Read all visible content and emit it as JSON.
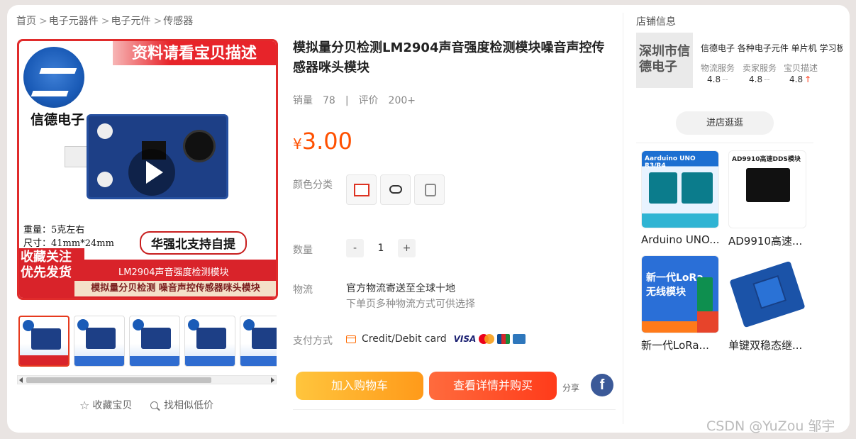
{
  "breadcrumb": [
    "首页",
    "电子元器件",
    "电子元件",
    "传感器"
  ],
  "breadcrumb_sep": ">",
  "main_image": {
    "banner": "资料请看宝贝描述",
    "brand": "信德电子",
    "weight": "重量：5克左右",
    "size": "尺寸：41mm*24mm",
    "support": "华强北支持自提",
    "favorite_tag_line1": "收藏关注",
    "favorite_tag_line2": "优先发货",
    "band_line1": "LM2904声音强度检测模块",
    "band_line2": "模拟量分贝检测  噪音声控传感器咪头模块",
    "play_icon": "play-icon"
  },
  "thumbnails_count": 5,
  "under_image": {
    "favorite": "收藏宝贝",
    "find_similar": "找相似低价"
  },
  "product": {
    "title": "模拟量分贝检测LM2904声音强度检测模块噪音声控传感器咪头模块",
    "sales_label": "销量",
    "sales_value": "78",
    "divider": "|",
    "review_label": "评价",
    "review_value": "200+",
    "currency": "¥",
    "price": "3.00",
    "color_label": "颜色分类",
    "qty_label": "数量",
    "qty_minus": "-",
    "qty_value": "1",
    "qty_plus": "+",
    "shipping_label": "物流",
    "shipping_line1": "官方物流寄送至全球十地",
    "shipping_line2": "下单页多种物流方式可供选择",
    "payment_label": "支付方式",
    "payment_method": "Credit/Debit card",
    "visa": "VISA",
    "add_to_cart": "加入购物车",
    "buy_now": "查看详情并购买",
    "share": "分享",
    "facebook": "f"
  },
  "store": {
    "header": "店铺信息",
    "logo_text": "深圳市信德电子",
    "name": "信德电子 各种电子元件 单片机 学习板 模块",
    "services": [
      {
        "label": "物流服务",
        "value": "4.8",
        "trend": "--"
      },
      {
        "label": "卖家服务",
        "value": "4.8",
        "trend": "--"
      },
      {
        "label": "宝贝描述",
        "value": "4.8",
        "trend": "↑"
      }
    ],
    "visit_button": "进店逛逛"
  },
  "recommendations": [
    {
      "name": "Arduino UNO...",
      "header": "Aarduino UNO R3/R4"
    },
    {
      "name": "AD9910高速...",
      "header": "AD9910高速DDS模块"
    },
    {
      "name": "新一代LoRa...",
      "header1": "新一代LoRa",
      "header2": "无线模块"
    },
    {
      "name": "单键双稳态继..."
    }
  ],
  "watermark": "CSDN @YuZou 邹宇",
  "colors": {
    "price": "#ff5000",
    "cart_button": "#ff9a1a",
    "buy_button": "#ff3b1a",
    "facebook": "#3b5998"
  }
}
